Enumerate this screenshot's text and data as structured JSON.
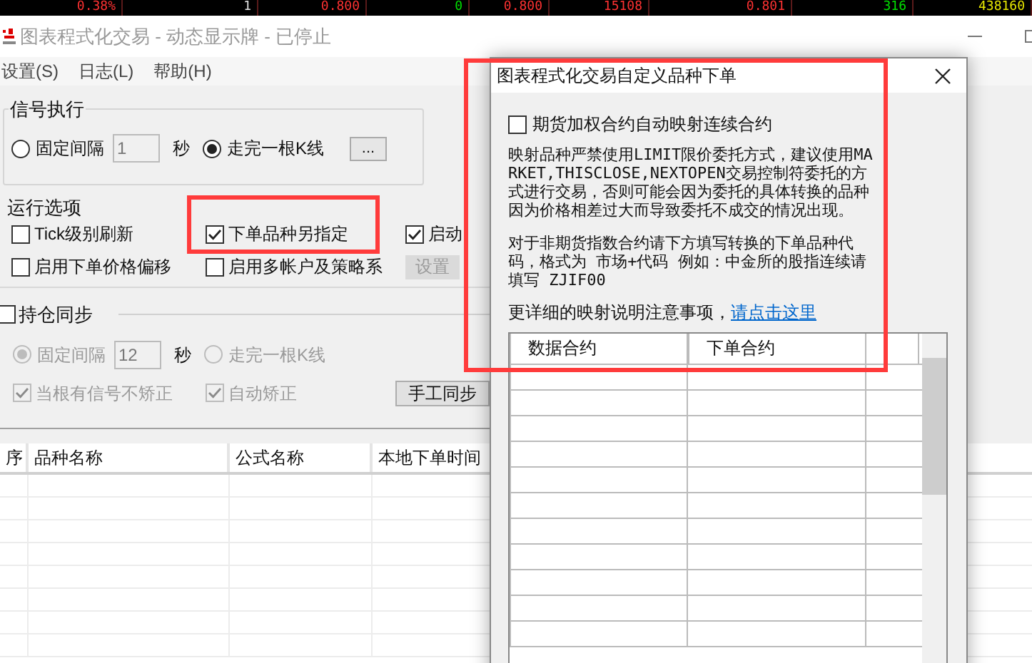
{
  "ticker": [
    {
      "text": "0.38%",
      "color": "#ff3232"
    },
    {
      "text": "1",
      "color": "#e0e0e0"
    },
    {
      "text": "0.800",
      "color": "#ff3232"
    },
    {
      "text": "0",
      "color": "#00e000"
    },
    {
      "text": "0.800",
      "color": "#ff3232"
    },
    {
      "text": "15108",
      "color": "#ff3232"
    },
    {
      "text": "0.801",
      "color": "#ff3232"
    },
    {
      "text": "316",
      "color": "#00e000"
    },
    {
      "text": "438160",
      "color": "#e6e600"
    }
  ],
  "window": {
    "title": "图表程式化交易 - 动态显示牌 - 已停止"
  },
  "menu": [
    "设置(S)",
    "日志(L)",
    "帮助(H)"
  ],
  "signal_group": {
    "title": "信号执行",
    "options": [
      {
        "label": "固定间隔",
        "selected": false
      },
      {
        "label": "走完一根K线",
        "selected": true
      }
    ],
    "interval": "1",
    "unit": "秒",
    "more_button": "..."
  },
  "run_options": {
    "title": "运行选项",
    "checkboxes": [
      {
        "label": "Tick级别刷新",
        "checked": false
      },
      {
        "label": "下单品种另指定",
        "checked": true
      },
      {
        "label": "启动",
        "checked": true
      },
      {
        "label": "启用下单价格偏移",
        "checked": false
      },
      {
        "label": "启用多帐户及策略系",
        "checked": false
      }
    ],
    "settings_button": {
      "label": "设置",
      "disabled": true
    }
  },
  "position_sync": {
    "label": "持仓同步",
    "checked": false,
    "options": [
      {
        "label": "固定间隔",
        "selected": true
      },
      {
        "label": "走完一根K线",
        "selected": false
      }
    ],
    "interval": "12",
    "unit": "秒",
    "checkboxes": [
      {
        "label": "当根有信号不矫正",
        "checked": true
      },
      {
        "label": "自动矫正",
        "checked": true
      }
    ],
    "button": "手工同步"
  },
  "table": {
    "columns": [
      "序",
      "品种名称",
      "公式名称",
      "本地下单时间"
    ]
  },
  "dialog": {
    "title": "图表程式化交易自定义品种下单",
    "checkbox": {
      "label": "期货加权合约自动映射连续合约",
      "checked": false
    },
    "paragraphs": [
      "映射品种严禁使用LIMIT限价委托方式，建议使用MARKET,THISCLOSE,NEXTOPEN交易控制符委托的方式进行交易，否则可能会因为委托的具体转换的品种因为价格相差过大而导致委托不成交的情况出现。",
      "对于非期货指数合约请下方填写转换的下单品种代码，格式为 市场+代码 例如：中金所的股指连续请填写 ZJIF00"
    ],
    "help_text": "更详细的映射说明注意事项，",
    "help_link": "请点击这里",
    "grid": {
      "columns": [
        "数据合约",
        "下单合约"
      ]
    }
  }
}
